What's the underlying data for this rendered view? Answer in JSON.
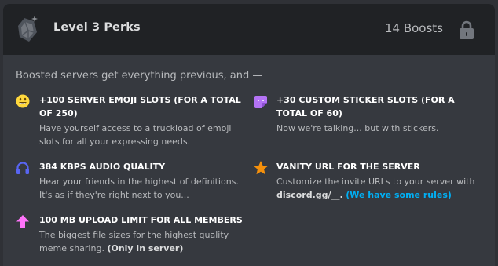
{
  "header": {
    "title": "Level 3 Perks",
    "boost_count": "14 Boosts",
    "gem_icon": "boost-gem-icon",
    "lock_icon": "lock-icon"
  },
  "intro": "Boosted servers get everything previous, and —",
  "perks": [
    {
      "icon": "emoji-smile-icon",
      "title": "+100 SERVER EMOJI SLOTS (FOR A TOTAL OF 250)",
      "description": "Have yourself access to a truckload of emoji slots for all your expressing needs."
    },
    {
      "icon": "sticker-icon",
      "title": "+30 CUSTOM STICKER SLOTS (FOR A TOTAL OF 60)",
      "description": "Now we're talking... but with stickers."
    },
    {
      "icon": "headphones-icon",
      "title": "384 KBPS AUDIO QUALITY",
      "description": "Hear your friends in the highest of definitions. It's as if they're right next to you..."
    },
    {
      "icon": "star-icon",
      "title": "VANITY URL FOR THE SERVER",
      "description": "Customize the invite URLs to your server with",
      "vanity_url": "discord.gg/__.",
      "link_text": "(We have some rules)"
    },
    {
      "icon": "upload-arrow-icon",
      "title": "100 MB UPLOAD LIMIT FOR ALL MEMBERS",
      "description": "The biggest file sizes for the highest quality meme sharing.",
      "note": "(Only in server)"
    }
  ],
  "colors": {
    "background": "#2f3136",
    "card": "#36393f",
    "header": "#202225",
    "emoji": "#ffd83d",
    "sticker": "#b473f5",
    "headphones": "#5865f2",
    "star": "#f4900c",
    "upload": "#ff73fa",
    "link": "#00aff4"
  }
}
